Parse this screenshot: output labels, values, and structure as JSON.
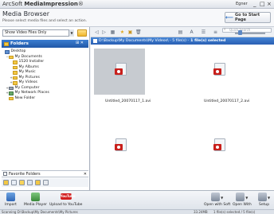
{
  "window": {
    "brand": "ArcSoft",
    "product": "MediaImpression",
    "suffix": "®",
    "user": "Egner",
    "min_glyph": "_",
    "max_glyph": "□",
    "close_glyph": "×"
  },
  "header": {
    "title": "Media Browser",
    "subtitle": "Please select media files and select an action.",
    "start_page_label": "Go to Start Page"
  },
  "left_panel": {
    "filter_value": "Show Video Files Only",
    "folders_title": "Folders",
    "folders_menu": "⊞ ✕",
    "tree": [
      {
        "label": "Desktop",
        "icon": "desktop-icon",
        "level": 0,
        "expander": ""
      },
      {
        "label": "My Documents",
        "icon": "folder-icon",
        "level": 1,
        "expander": "−"
      },
      {
        "label": "1520 Installer",
        "icon": "folder-icon",
        "level": 2,
        "expander": ""
      },
      {
        "label": "My Albums",
        "icon": "folder-icon",
        "level": 2,
        "expander": ""
      },
      {
        "label": "My Music",
        "icon": "folder-icon",
        "level": 2,
        "expander": ""
      },
      {
        "label": "My Pictures",
        "icon": "folder-icon",
        "level": 2,
        "expander": "+"
      },
      {
        "label": "My Videos",
        "icon": "folder-icon",
        "level": 2,
        "expander": "+"
      },
      {
        "label": "My Computer",
        "icon": "computer-icon",
        "level": 1,
        "expander": "+"
      },
      {
        "label": "My Network Places",
        "icon": "network-icon",
        "level": 1,
        "expander": "+"
      },
      {
        "label": "New Folder",
        "icon": "folder-icon",
        "level": 1,
        "expander": ""
      }
    ],
    "favorites_title": "Favorite Folders"
  },
  "right_panel": {
    "search_placeholder": "Quick Search",
    "path": "D:\\Backup\\My Documents\\My Videos\\ - 5 file(s) - ",
    "selection": "1 file(s) selected",
    "files": [
      {
        "name": "Untitled_20070117_1.avi",
        "selected": true
      },
      {
        "name": "Untitled_20070117_2.avi",
        "selected": false
      },
      {
        "name": "",
        "selected": false
      },
      {
        "name": "",
        "selected": false
      }
    ]
  },
  "actions": {
    "left": [
      {
        "label": "Import",
        "icon": "import-icon"
      },
      {
        "label": "Media Player",
        "icon": "media-player-icon"
      },
      {
        "label": "Upload to YouTube",
        "icon": "youtube-icon"
      }
    ],
    "youtube_badge": "YouTube",
    "right": [
      {
        "label": "Open with Soft",
        "icon": "openwith-soft-icon"
      },
      {
        "label": "Open With",
        "icon": "openwith-icon"
      },
      {
        "label": "Setup",
        "icon": "setup-icon"
      }
    ]
  },
  "status": {
    "left": "Scanning D:\\Backup\\My Documents\\My Pictures",
    "size": "33.24MB",
    "count": "1 file(s) selected / 5 file(s)"
  }
}
